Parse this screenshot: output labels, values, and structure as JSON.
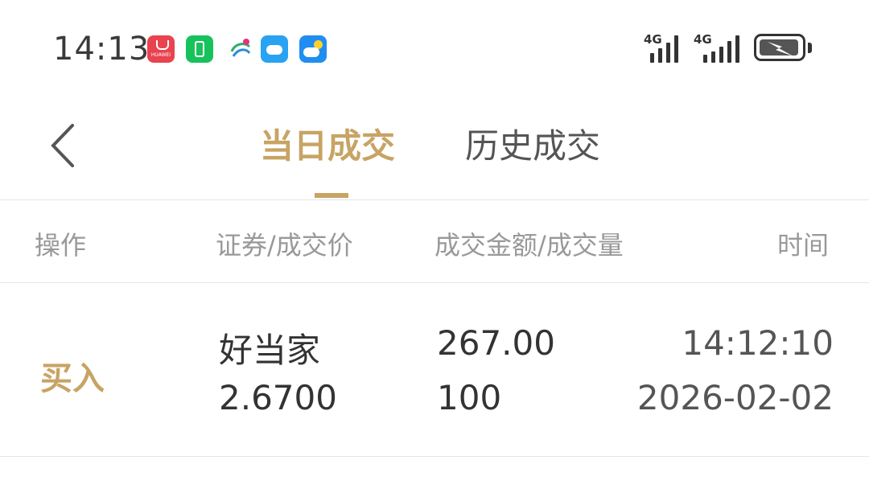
{
  "status_bar": {
    "time": "14:13",
    "huawei_label": "HUAWEI",
    "signal1_label": "4G",
    "signal2_label": "4G"
  },
  "header": {
    "tabs": [
      {
        "label": "当日成交",
        "active": true
      },
      {
        "label": "历史成交",
        "active": false
      }
    ]
  },
  "table": {
    "columns": [
      "操作",
      "证券/成交价",
      "成交金额/成交量",
      "时间"
    ],
    "rows": [
      {
        "action": "买入",
        "security": "好当家",
        "price": "2.6700",
        "amount": "267.00",
        "volume": "100",
        "time": "14:12:10",
        "date": "2026-02-02"
      }
    ]
  },
  "colors": {
    "accent": "#c7a464",
    "text": "#333333",
    "muted": "#999999"
  }
}
